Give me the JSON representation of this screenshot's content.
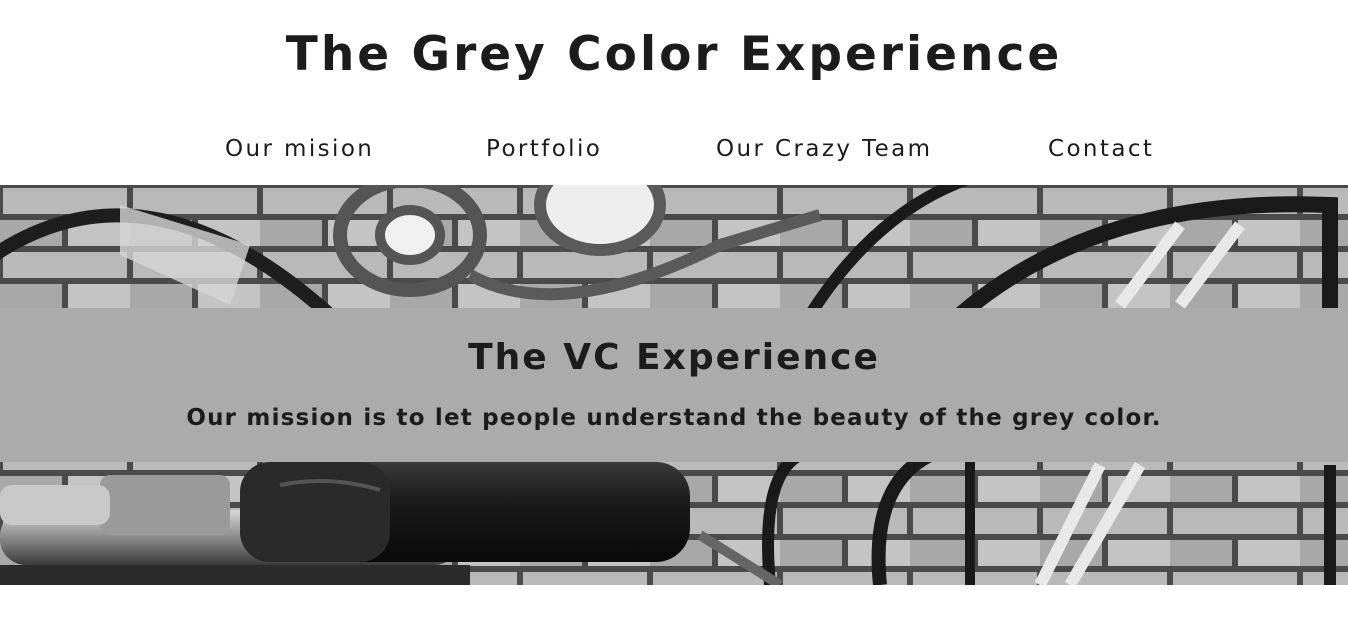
{
  "header": {
    "title": "The Grey Color Experience"
  },
  "nav": {
    "items": [
      {
        "label": "Our mision"
      },
      {
        "label": "Portfolio"
      },
      {
        "label": "Our Crazy Team"
      },
      {
        "label": "Contact"
      }
    ]
  },
  "hero": {
    "image_description": "black-and-white-graffiti-brick-wall-with-bicycle-handlebar"
  },
  "banner": {
    "title": "The VC Experience",
    "text": "Our mission is to let people understand the beauty of the grey color."
  },
  "colors": {
    "text": "#1c1c1c",
    "banner_bg": "#ababab",
    "page_bg": "#ffffff"
  }
}
